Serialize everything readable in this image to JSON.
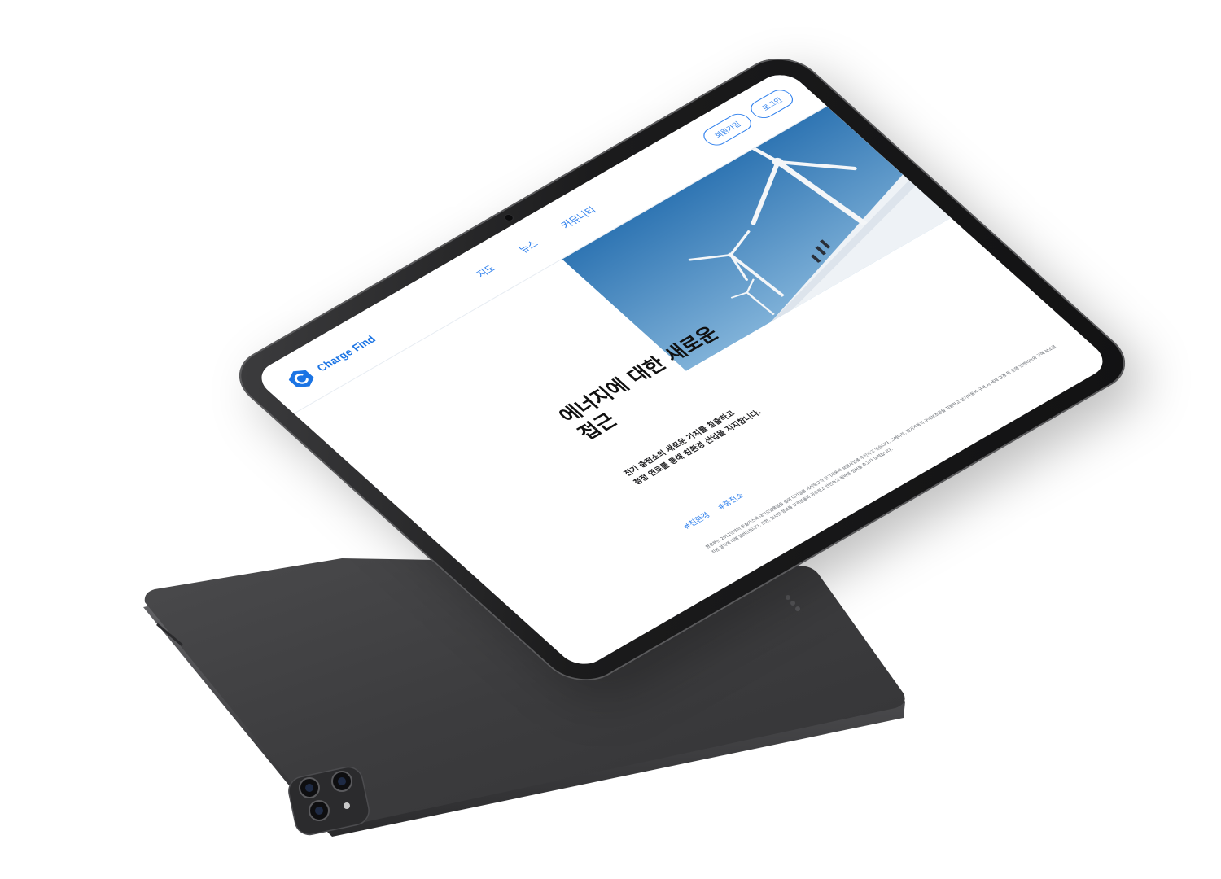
{
  "site": {
    "brand_name": "Charge Find",
    "logo_letter": "C",
    "nav": [
      {
        "label": "지도"
      },
      {
        "label": "뉴스"
      },
      {
        "label": "커뮤니티"
      }
    ],
    "auth": {
      "signup_label": "회원가입",
      "login_label": "로그인"
    }
  },
  "hero": {
    "headline_line1": "에너지에 대한 새로운",
    "headline_line2": "접근",
    "tagline_line1": "전기 충전소의 새로운 가치를 창출하고",
    "tagline_line2": "청정 연료를 통해 친환경 산업을 지지합니다.",
    "tags": [
      "#친환경",
      "#충전소"
    ],
    "body_text": "환경부는 2011년부터 온실가스와 대기오염물질을 줄여 대기질을 개선하고자 전기자동차 보급사업을 추진하고 있습니다. 그에따라, 전기자동차 구매보조금을 지원하고 전기자동차 구매 시 세제 감경 등 운행 인센티브와 구매 보조금 지원 절차에 대해 알려드립니다. 또한, 실시간 정보를 고객분들과 공유하고 안전하고 올바른 정보를 주고자 노력합니다."
  },
  "colors": {
    "brand_blue": "#1b74e4",
    "link_blue": "#2f80ed",
    "device_dark": "#3a3a3c",
    "sky_blue": "#3b7fb8"
  },
  "icons": {
    "logo": "hexagon-c-logo-icon",
    "camera": "rear-camera-icon"
  }
}
